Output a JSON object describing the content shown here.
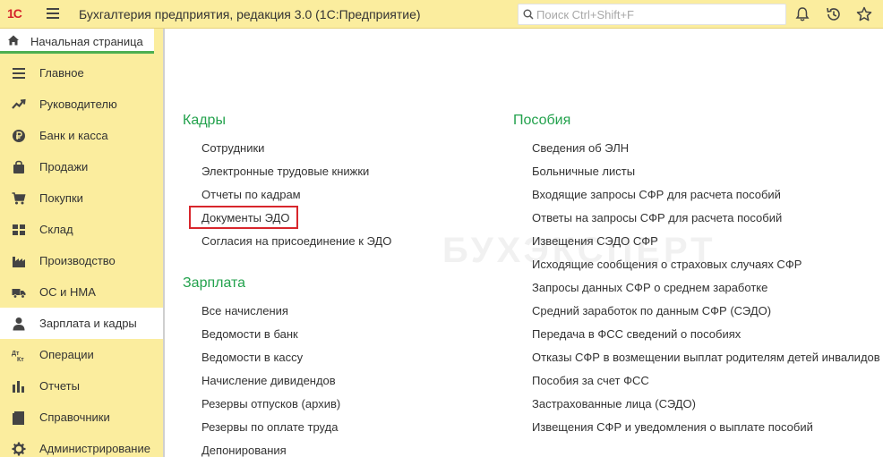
{
  "header": {
    "logo_text": "1С",
    "app_title": "Бухгалтерия предприятия, редакция 3.0  (1С:Предприятие)",
    "search_placeholder": "Поиск Ctrl+Shift+F"
  },
  "home_tab": {
    "label": "Начальная страница"
  },
  "sidebar": {
    "items": [
      {
        "label": "Главное",
        "icon": "menu-lines-icon"
      },
      {
        "label": "Руководителю",
        "icon": "trend-icon"
      },
      {
        "label": "Банк и касса",
        "icon": "ruble-icon"
      },
      {
        "label": "Продажи",
        "icon": "bag-icon"
      },
      {
        "label": "Покупки",
        "icon": "cart-icon"
      },
      {
        "label": "Склад",
        "icon": "warehouse-icon"
      },
      {
        "label": "Производство",
        "icon": "factory-icon"
      },
      {
        "label": "ОС и НМА",
        "icon": "truck-icon"
      },
      {
        "label": "Зарплата и кадры",
        "icon": "person-icon",
        "active": true
      },
      {
        "label": "Операции",
        "icon": "dt-kt-icon"
      },
      {
        "label": "Отчеты",
        "icon": "bar-chart-icon"
      },
      {
        "label": "Справочники",
        "icon": "book-icon"
      },
      {
        "label": "Администрирование",
        "icon": "gear-icon"
      }
    ]
  },
  "content": {
    "kadry": {
      "title": "Кадры",
      "links": [
        "Сотрудники",
        "Электронные трудовые книжки",
        "Отчеты по кадрам",
        "Документы ЭДО",
        "Согласия на присоединение к ЭДО"
      ]
    },
    "zarplata": {
      "title": "Зарплата",
      "links": [
        "Все начисления",
        "Ведомости в банк",
        "Ведомости в кассу",
        "Начисление дивидендов",
        "Резервы отпусков (архив)",
        "Резервы по оплате труда",
        "Депонирования"
      ]
    },
    "posobiya": {
      "title": "Пособия",
      "links": [
        "Сведения об ЭЛН",
        "Больничные листы",
        "Входящие запросы СФР для расчета пособий",
        "Ответы на запросы СФР для расчета пособий",
        "Извещения СЭДО СФР",
        "Исходящие сообщения о страховых случаях СФР",
        "Запросы данных СФР о среднем заработке",
        "Средний заработок по данным СФР (СЭДО)",
        "Передача в ФСС сведений о пособиях",
        "Отказы СФР в возмещении выплат родителям детей инвалидов",
        "Пособия за счет ФСС",
        "Застрахованные лица (СЭДО)",
        "Извещения СФР и уведомления о выплате пособий"
      ]
    },
    "watermark": "БУХЭКСПЕРТ"
  },
  "colors": {
    "sidebar_bg": "#fbed9e",
    "section_title": "#23a24d",
    "highlight": "#d8262c"
  }
}
